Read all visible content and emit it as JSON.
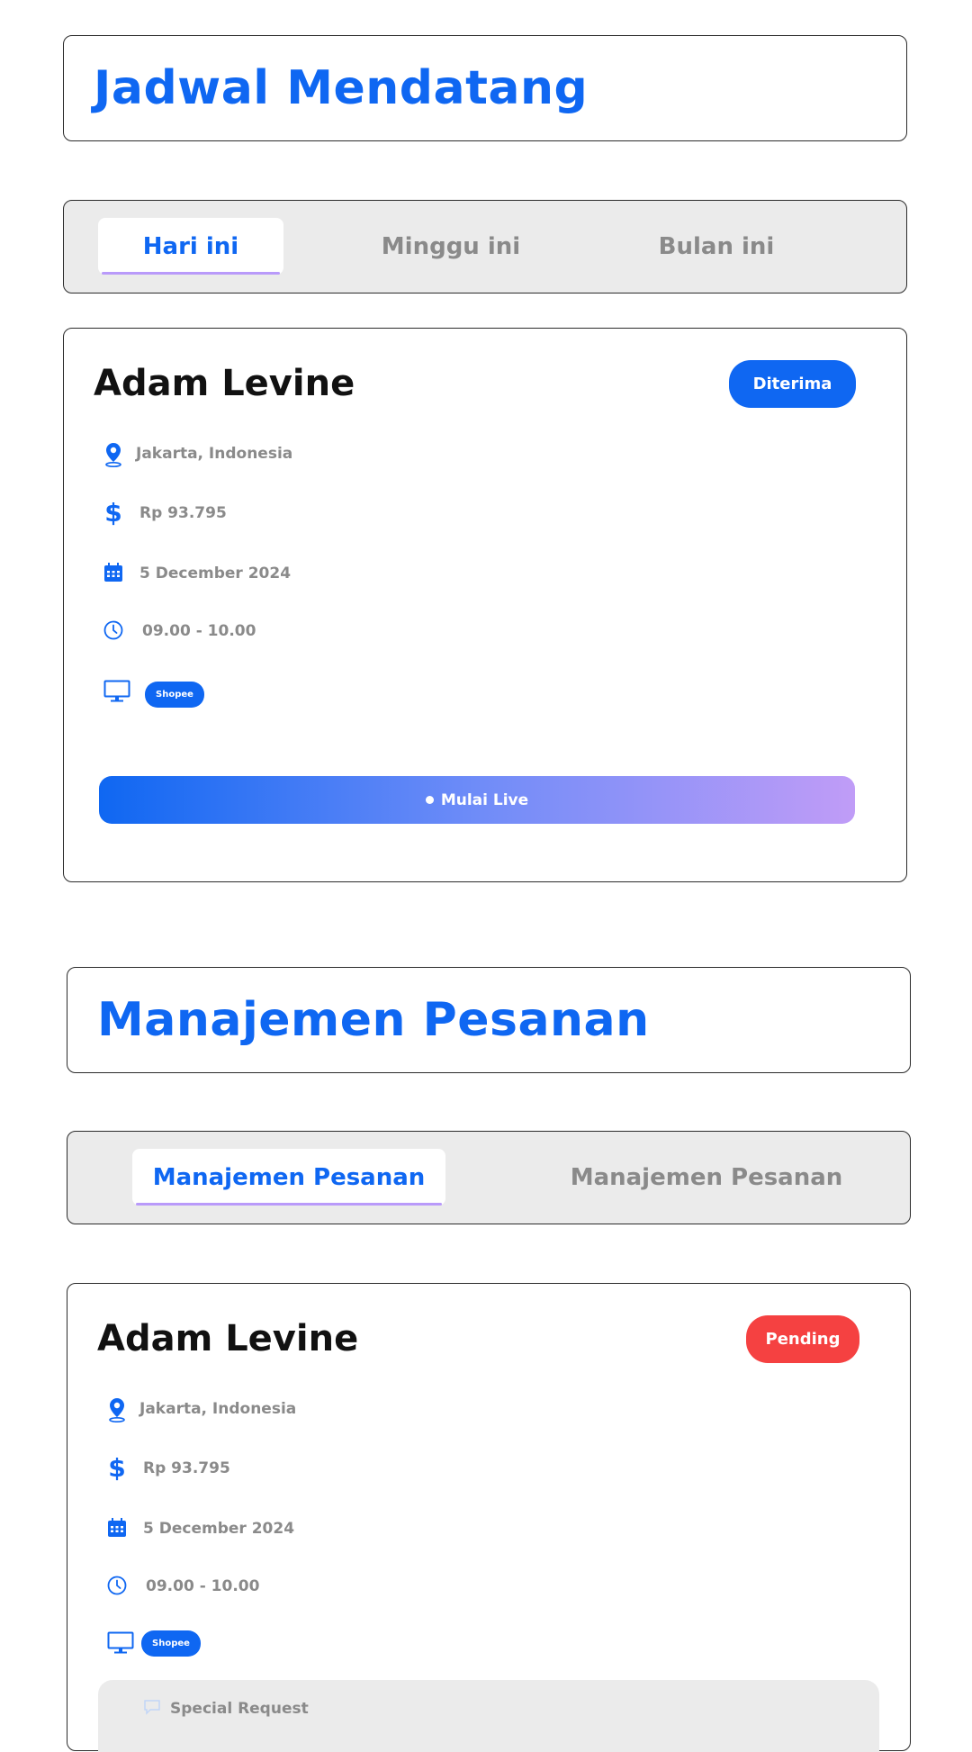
{
  "schedule": {
    "title": "Jadwal Mendatang",
    "tabs": [
      {
        "label": "Hari ini",
        "active": true
      },
      {
        "label": "Minggu ini",
        "active": false
      },
      {
        "label": "Bulan ini",
        "active": false
      }
    ],
    "card": {
      "name": "Adam Levine",
      "status": "Diterima",
      "status_color": "#0f67f2",
      "location": "Jakarta, Indonesia",
      "price": "Rp 93.795",
      "date": "5 December 2024",
      "time": "09.00 - 10.00",
      "platform": "Shopee",
      "action_label": "Mulai Live"
    }
  },
  "orders": {
    "title": "Manajemen Pesanan",
    "tabs": [
      {
        "label": "Manajemen Pesanan",
        "active": true
      },
      {
        "label": "Manajemen Pesanan",
        "active": false
      }
    ],
    "card": {
      "name": "Adam Levine",
      "status": "Pending",
      "status_color": "#f54141",
      "location": "Jakarta, Indonesia",
      "price": "Rp 93.795",
      "date": "5 December 2024",
      "time": "09.00 - 10.00",
      "platform": "Shopee",
      "special_request_label": "Special Request"
    }
  },
  "colors": {
    "accent": "#0f67f2",
    "accent_soft": "#b99afa",
    "muted_text": "#8a8a8a",
    "panel_bg": "#ebebeb"
  }
}
